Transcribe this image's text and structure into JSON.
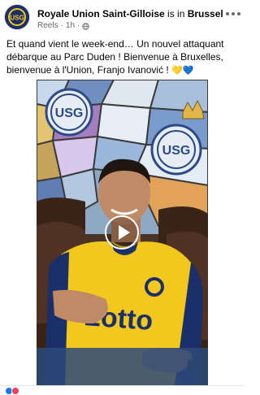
{
  "post": {
    "page_name": "Royale Union Saint-Gilloise",
    "connector": " is in ",
    "location": "Brussels",
    "location_suffix": ".",
    "meta_type": "Reels",
    "meta_dot": "·",
    "meta_time": "1h",
    "meta_dot2": "·",
    "caption": "Et quand vient le week-end… Un nouvel attaquant débarque au Parc Duden ! Bienvenue à Bruxelles, bienvenue à l'Union, Franjo Ivanović ! ",
    "caption_emoji": "💛💙"
  },
  "icons": {
    "avatar": "club-crest-icon",
    "privacy": "globe-icon",
    "menu": "more-options-icon",
    "play": "play-icon"
  },
  "colors": {
    "navy": "#1b2f6b",
    "yellow": "#f2c81e",
    "meta_text": "#65676b",
    "reaction_like": "#1877f2",
    "reaction_love": "#f33e58"
  }
}
